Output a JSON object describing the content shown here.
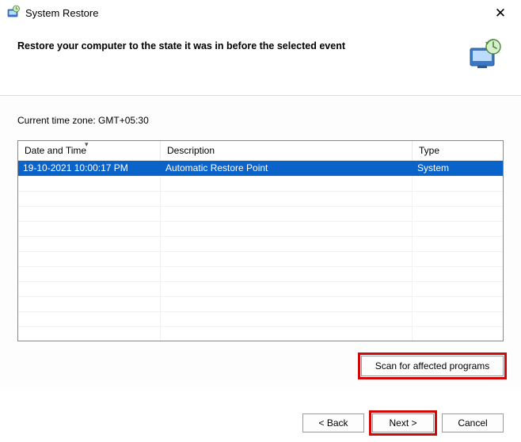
{
  "window": {
    "title": "System Restore",
    "close_glyph": "✕"
  },
  "header": {
    "heading": "Restore your computer to the state it was in before the selected event"
  },
  "timezone_label": "Current time zone: GMT+05:30",
  "columns": {
    "datetime": "Date and Time",
    "description": "Description",
    "type": "Type"
  },
  "rows": [
    {
      "datetime": "19-10-2021 10:00:17 PM",
      "description": "Automatic Restore Point",
      "type": "System",
      "selected": true
    }
  ],
  "buttons": {
    "scan": "Scan for affected programs",
    "back": "< Back",
    "next": "Next >",
    "cancel": "Cancel"
  }
}
